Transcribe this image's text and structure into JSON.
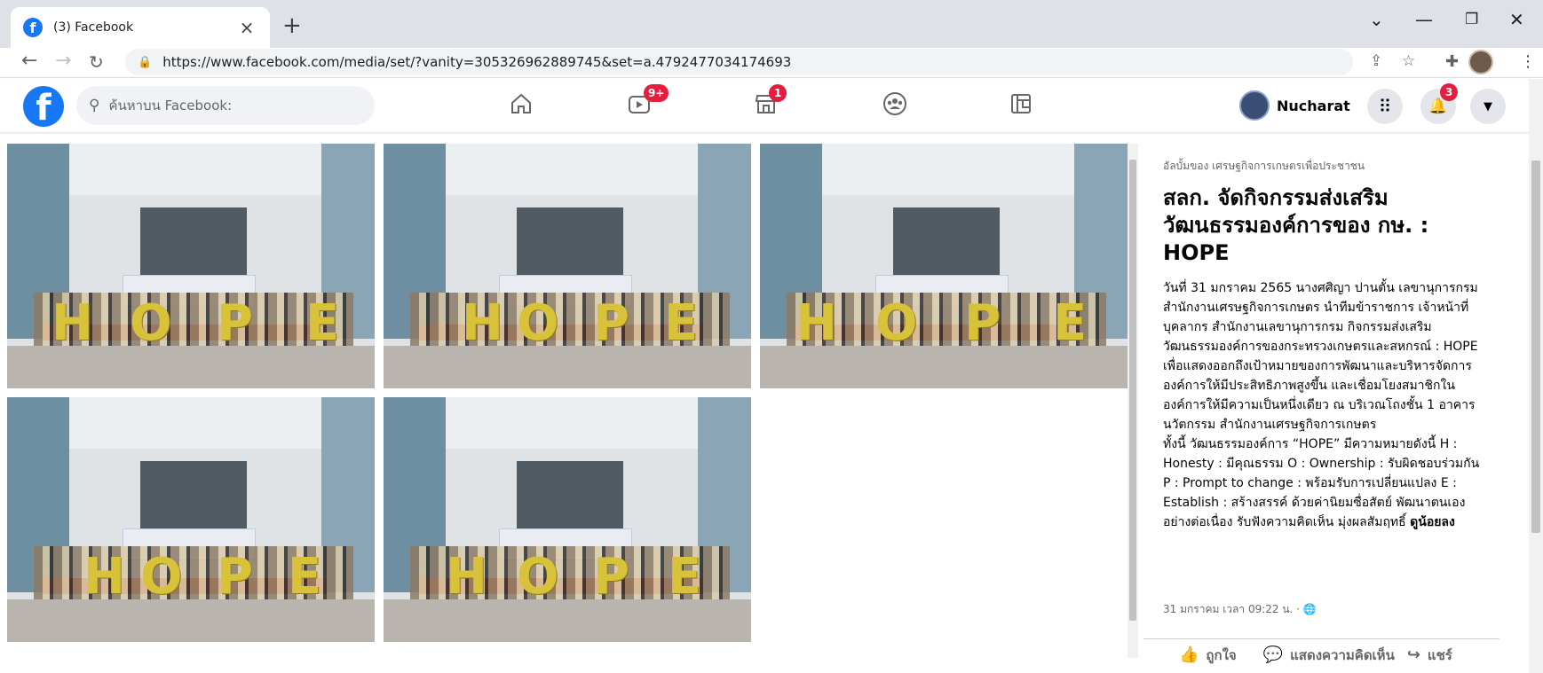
{
  "browser": {
    "tab_title": "(3) Facebook",
    "tab_close": "×",
    "new_tab": "+",
    "url": "https://www.facebook.com/media/set/?vanity=305326962889745&set=a.4792477034174693",
    "icons": [
      "back-icon",
      "forward-icon",
      "reload-icon",
      "lock-icon",
      "share-icon",
      "star-icon",
      "extensions-icon",
      "menu-icon"
    ]
  },
  "facebook": {
    "search_placeholder": "ค้นหาบน Facebook:",
    "badges": {
      "watch": "9+",
      "marketplace": "1",
      "notifications": "3"
    },
    "user_name": "Nucharat",
    "brand_color": "#1877f2",
    "badge_color": "#e41e3f"
  },
  "album": {
    "hope_letters": [
      "H",
      "O",
      "P",
      "E"
    ]
  },
  "panel": {
    "album_of": "อัลบั้มของ เศรษฐกิจการเกษตรเพื่อประชาชน",
    "title": "สลก. จัดกิจกรรมส่งเสริมวัฒนธรรมองค์การของ กษ. : HOPE",
    "description": "วันที่ 31 มกราคม 2565 นางศศิญา ปานตั้น เลขานุการกรม สำนักงานเศรษฐกิจการเกษตร นำทีมข้าราชการ เจ้าหน้าที่ บุคลากร สำนักงานเลขานุการกรม กิจกรรมส่งเสริมวัฒนธรรมองค์การของกระทรวงเกษตรและสหกรณ์ : HOPE เพื่อแสดงออกถึงเป้าหมายของการพัฒนาและบริหารจัดการองค์การให้มีประสิทธิภาพสูงขึ้น และเชื่อมโยงสมาชิกในองค์การให้มีความเป็นหนึ่งเดียว ณ บริเวณโถงชั้น 1 อาคารนวัตกรรม สำนักงานเศรษฐกิจการเกษตร",
    "description2": "ทั้งนี้ วัฒนธรรมองค์การ “HOPE” มีความหมายดังนี้ H : Honesty : มีคุณธรรม O : Ownership : รับผิดชอบร่วมกัน P : Prompt to change : พร้อมรับการเปลี่ยนแปลง E : Establish : สร้างสรรค์ ด้วยค่านิยมซื่อสัตย์ พัฒนาตนเองอย่างต่อเนื่อง รับฟังความคิดเห็น มุ่งผลสัมฤทธิ์",
    "see_less": "ดูน้อยลง",
    "meta": "31 มกราคม เวลา 09:22 น. · ",
    "like_label": "ถูกใจ",
    "comment_label": "แสดงความคิดเห็น",
    "share_label": "แชร์"
  }
}
